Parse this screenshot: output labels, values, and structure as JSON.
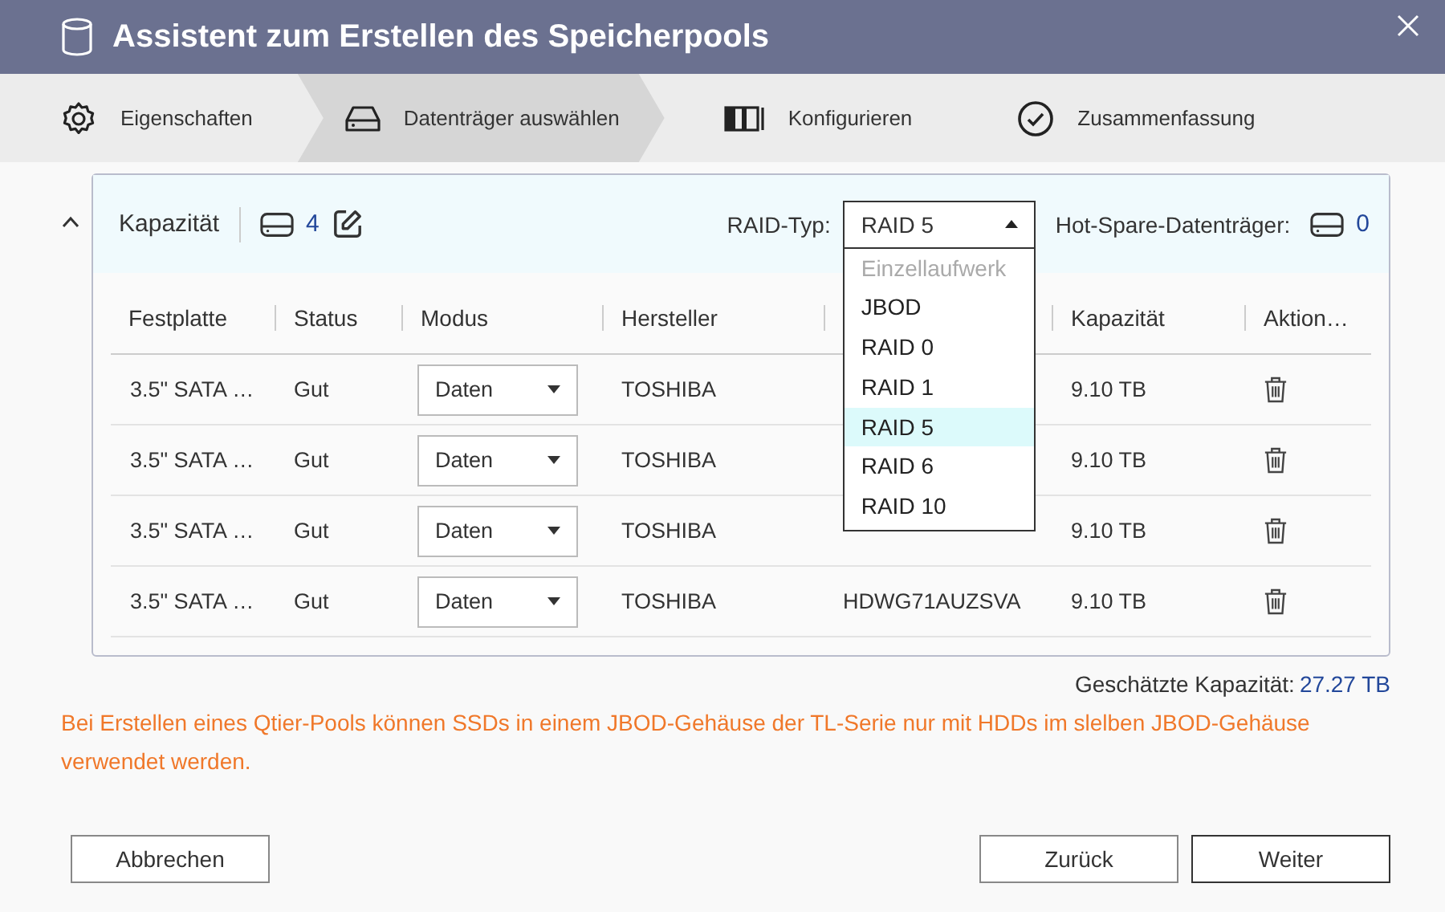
{
  "window": {
    "title": "Assistent zum Erstellen des Speicherpools"
  },
  "steps": [
    {
      "label": "Eigenschaften",
      "kind": "gear",
      "selected": false
    },
    {
      "label": "Datenträger auswählen",
      "kind": "drive",
      "selected": true
    },
    {
      "label": "Konfigurieren",
      "kind": "configure",
      "selected": false
    },
    {
      "label": "Zusammenfassung",
      "kind": "check",
      "selected": false
    }
  ],
  "panel": {
    "expanded": true,
    "title": "Kapazität",
    "disk_count": "4",
    "raid": {
      "label": "RAID-Typ:",
      "value": "RAID 5",
      "expanded": true,
      "options": [
        {
          "label": "Einzellaufwerk",
          "disabled": true,
          "selected": false
        },
        {
          "label": "JBOD",
          "disabled": false,
          "selected": false
        },
        {
          "label": "RAID 0",
          "disabled": false,
          "selected": false
        },
        {
          "label": "RAID 1",
          "disabled": false,
          "selected": false
        },
        {
          "label": "RAID 5",
          "disabled": false,
          "selected": true
        },
        {
          "label": "RAID 6",
          "disabled": false,
          "selected": false
        },
        {
          "label": "RAID 10",
          "disabled": false,
          "selected": false
        }
      ]
    },
    "hot_spare": {
      "label": "Hot-Spare-Datenträger:",
      "count": "0"
    },
    "table": {
      "columns": [
        "Festplatte",
        "Status",
        "Modus",
        "Hersteller",
        "",
        "Kapazität",
        "Aktion…"
      ],
      "rows": [
        {
          "disk": "3.5\" SATA …",
          "status": "Gut",
          "mode": "Daten",
          "vendor": "TOSHIBA",
          "capacity": "9.10 TB"
        },
        {
          "disk": "3.5\" SATA …",
          "status": "Gut",
          "mode": "Daten",
          "vendor": "TOSHIBA",
          "capacity": "9.10 TB"
        },
        {
          "disk": "3.5\" SATA …",
          "status": "Gut",
          "mode": "Daten",
          "vendor": "TOSHIBA",
          "capacity": "9.10 TB"
        },
        {
          "disk": "3.5\" SATA …",
          "status": "Gut",
          "mode": "Daten",
          "vendor": "TOSHIBA",
          "model": "HDWG71AUZSVA",
          "capacity": "9.10 TB"
        }
      ]
    }
  },
  "estimate": {
    "label": "Geschätzte Kapazität:",
    "value": "27.27 TB"
  },
  "warning": "Bei Erstellen eines Qtier-Pools können SSDs in einem JBOD-Gehäuse der TL-Serie nur mit HDDs im slelben JBOD-Gehäuse verwendet werden.",
  "buttons": {
    "left": [
      "Abbrechen"
    ],
    "right": [
      "Zurück",
      "Weiter"
    ]
  }
}
